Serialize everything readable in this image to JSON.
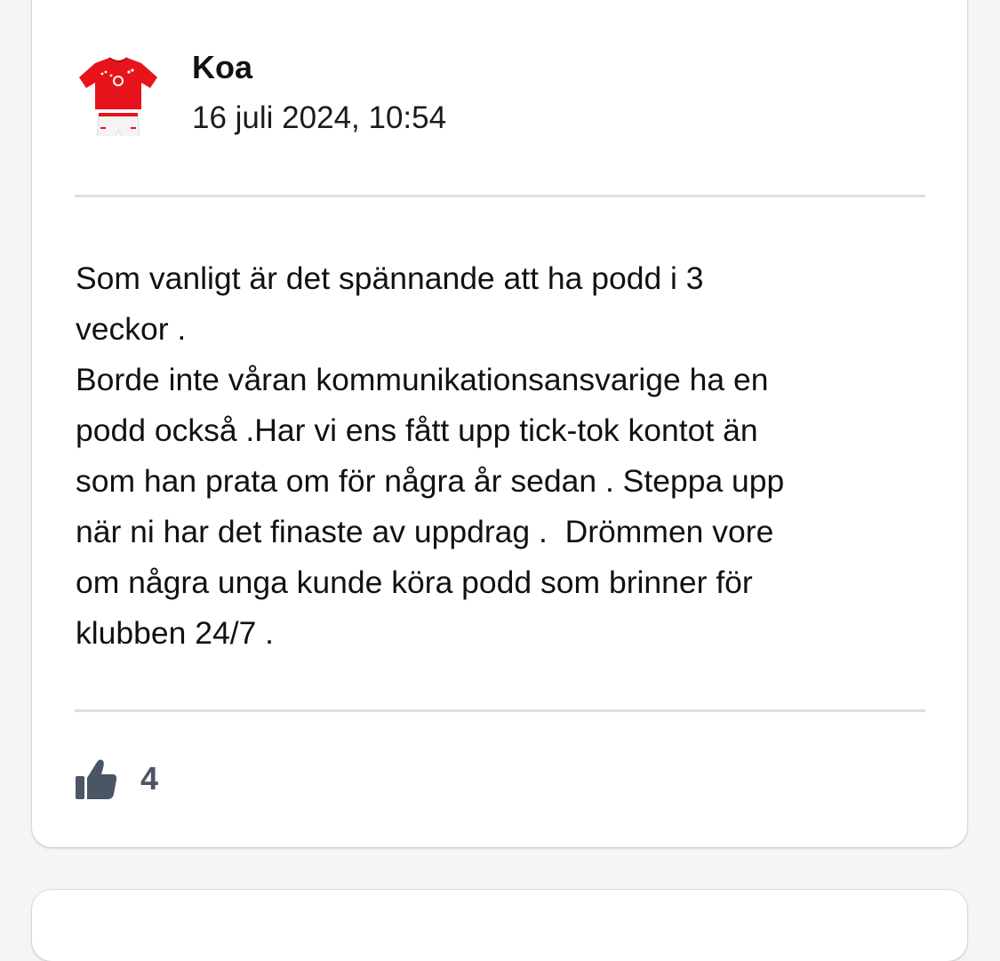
{
  "post": {
    "author": "Koa",
    "timestamp": "16 juli 2024, 10:54",
    "body": "Som vanligt är det spännande att ha podd i 3\nveckor .\nBorde inte våran kommunikationsansvarige ha en\npodd också .Har vi ens fått upp tick-tok kontot än\nsom han prata om för några år sedan . Steppa upp\nnär ni har det finaste av uppdrag .  Drömmen vore\nom några unga kunde köra podd som brinner för\nklubben 24/7 .",
    "avatar_icon": "red-football-kit-icon",
    "like_icon": "thumbs-up-icon",
    "like_count": "4"
  },
  "colors": {
    "card_background": "#ffffff",
    "page_background": "#f5f5f6",
    "divider": "#dedfe2",
    "like": "#4a5566",
    "jersey_red": "#e8141c"
  }
}
